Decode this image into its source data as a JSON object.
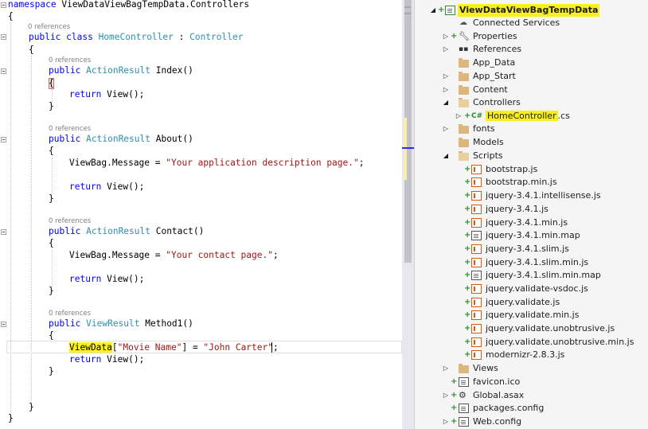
{
  "editor": {
    "lines": {
      "ns_kw": "namespace",
      "ns_name": " ViewDataViewBagTempData.Controllers",
      "open_ns": "{",
      "class_refs": "0 references",
      "class_public": "public",
      "class_kw": " class ",
      "class_name": "HomeController",
      "class_colon": " : ",
      "class_base": "Controller",
      "open_class": "{",
      "index_refs": "0 references",
      "index_public": "public",
      "index_type": " ActionResult",
      "index_sig": " Index()",
      "index_open": "{",
      "index_return_kw": "return",
      "index_return_rest": " View();",
      "index_close": "}",
      "about_refs": "0 references",
      "about_public": "public",
      "about_type": " ActionResult",
      "about_sig": " About()",
      "about_open": "{",
      "about_msg_a": "ViewBag.Message = ",
      "about_msg_str": "\"Your application description page.\"",
      "about_msg_end": ";",
      "about_return_kw": "return",
      "about_return_rest": " View();",
      "about_close": "}",
      "contact_refs": "0 references",
      "contact_public": "public",
      "contact_type": " ActionResult",
      "contact_sig": " Contact()",
      "contact_open": "{",
      "contact_msg_a": "ViewBag.Message = ",
      "contact_msg_str": "\"Your contact page.\"",
      "contact_msg_end": ";",
      "contact_return_kw": "return",
      "contact_return_rest": " View();",
      "contact_close": "}",
      "method1_refs": "0 references",
      "method1_public": "public",
      "method1_type": " ViewResult",
      "method1_sig": " Method1()",
      "method1_open": "{",
      "viewdata_word": "ViewData",
      "viewdata_open": "[",
      "viewdata_key": "\"Movie Name\"",
      "viewdata_mid": "] = ",
      "viewdata_val": "\"John Carter\"",
      "viewdata_end": ";",
      "method1_return_kw": "return",
      "method1_return_rest": " View();",
      "method1_close": "}",
      "class_close": "}",
      "ns_close": "}"
    }
  },
  "solution_explorer": {
    "project": "ViewDataViewBagTempData",
    "items": {
      "connected_services": "Connected Services",
      "properties": "Properties",
      "references": "References",
      "app_data": "App_Data",
      "app_start": "App_Start",
      "content": "Content",
      "controllers": "Controllers",
      "home_controller": "HomeController",
      "home_controller_ext": ".cs",
      "fonts": "fonts",
      "models": "Models",
      "scripts": "Scripts",
      "views": "Views",
      "favicon": "favicon.ico",
      "global_asax": "Global.asax",
      "packages_config": "packages.config",
      "web_config": "Web.config"
    },
    "scripts": [
      "bootstrap.js",
      "bootstrap.min.js",
      "jquery-3.4.1.intellisense.js",
      "jquery-3.4.1.js",
      "jquery-3.4.1.min.js",
      "jquery-3.4.1.min.map",
      "jquery-3.4.1.slim.js",
      "jquery-3.4.1.slim.min.js",
      "jquery-3.4.1.slim.min.map",
      "jquery.validate-vsdoc.js",
      "jquery.validate.js",
      "jquery.validate.min.js",
      "jquery.validate.unobtrusive.js",
      "jquery.validate.unobtrusive.min.js",
      "modernizr-2.8.3.js"
    ]
  },
  "colors": {
    "keyword": "#0000ff",
    "type": "#2b91af",
    "string": "#a31515",
    "highlight": "#fdf21c"
  }
}
